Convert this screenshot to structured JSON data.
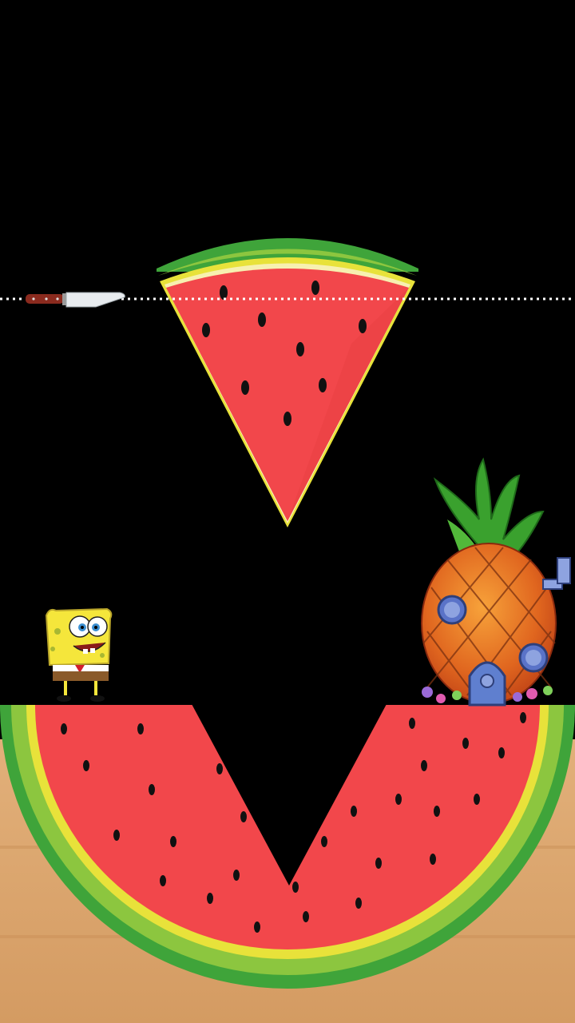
{
  "scene": {
    "background_color": "#000000",
    "table_color": "#d9a56c",
    "cut_line_color": "#ffffff"
  },
  "watermelon": {
    "flesh_color": "#f2474b",
    "rind_dark": "#3fa43a",
    "rind_light": "#8cc63f",
    "rind_yellow": "#e8e23a",
    "seed_color": "#111111"
  },
  "sprites": {
    "knife": "knife-icon",
    "character": "spongebob-character",
    "house": "pineapple-house"
  }
}
